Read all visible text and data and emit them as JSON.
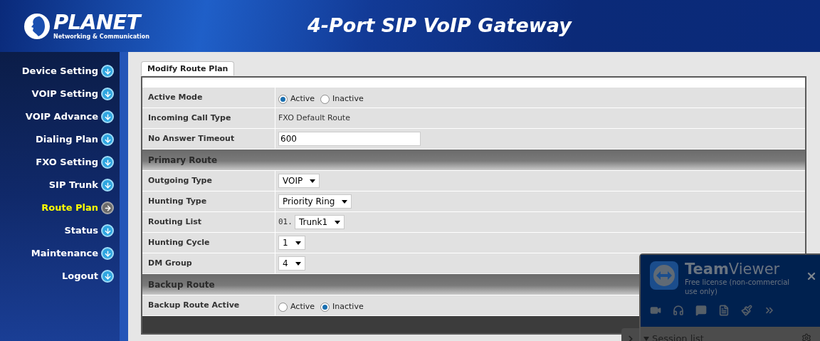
{
  "header": {
    "logo_name": "PLANET",
    "logo_tagline": "Networking & Communication",
    "title": "4-Port SIP VoIP Gateway"
  },
  "sidebar": {
    "items": [
      {
        "label": "Device Setting",
        "selected": false
      },
      {
        "label": "VOIP Setting",
        "selected": false
      },
      {
        "label": "VOIP Advance",
        "selected": false
      },
      {
        "label": "Dialing Plan",
        "selected": false
      },
      {
        "label": "FXO Setting",
        "selected": false
      },
      {
        "label": "SIP Trunk",
        "selected": false
      },
      {
        "label": "Route Plan",
        "selected": true
      },
      {
        "label": "Status",
        "selected": false
      },
      {
        "label": "Maintenance",
        "selected": false
      },
      {
        "label": "Logout",
        "selected": false
      }
    ]
  },
  "tab": {
    "label": "Modify Route Plan"
  },
  "form": {
    "rows": [
      {
        "kind": "radio",
        "label": "Active Mode",
        "options": [
          {
            "label": "Active",
            "selected": true
          },
          {
            "label": "Inactive",
            "selected": false
          }
        ]
      },
      {
        "kind": "text",
        "label": "Incoming Call Type",
        "value": "FXO Default Route"
      },
      {
        "kind": "input",
        "label": "No Answer Timeout",
        "value": "600"
      },
      {
        "kind": "section",
        "label": "Primary Route"
      },
      {
        "kind": "select",
        "label": "Outgoing Type",
        "value": "VOIP"
      },
      {
        "kind": "select",
        "label": "Hunting Type",
        "value": "Priority Ring"
      },
      {
        "kind": "select",
        "label": "Routing List",
        "prefix": "01.",
        "value": "Trunk1"
      },
      {
        "kind": "select",
        "label": "Hunting Cycle",
        "value": "1"
      },
      {
        "kind": "select",
        "label": "DM Group",
        "value": "4"
      },
      {
        "kind": "section",
        "label": "Backup Route"
      },
      {
        "kind": "radio",
        "label": "Backup Route Active",
        "options": [
          {
            "label": "Active",
            "selected": false
          },
          {
            "label": "Inactive",
            "selected": true
          }
        ]
      }
    ]
  },
  "teamviewer": {
    "brand_bold": "Team",
    "brand_light": "Viewer",
    "subtitle": "Free license (non-commercial use only)",
    "session_list": "Session list"
  }
}
